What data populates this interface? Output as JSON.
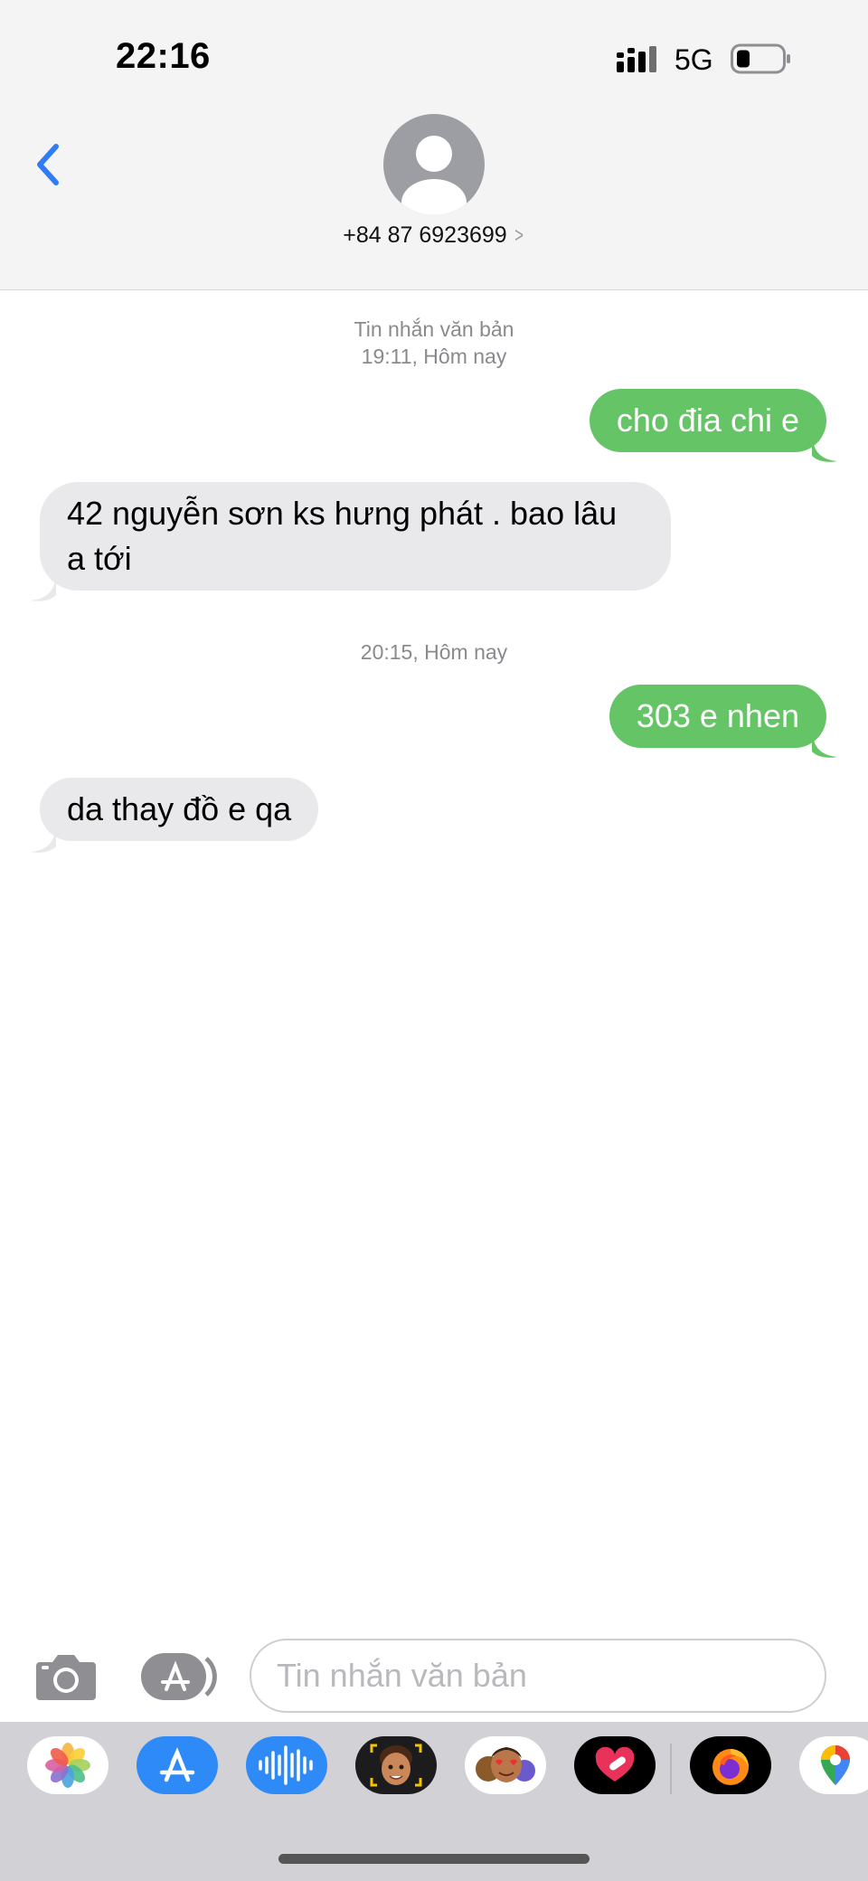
{
  "status_bar": {
    "time": "22:16",
    "network": "5G"
  },
  "header": {
    "contact": "+84 87 6923699"
  },
  "conversation": {
    "stamp1": {
      "label": "Tin nhắn văn bản",
      "time": "19:11",
      "day": "Hôm nay"
    },
    "stamp2": {
      "time": "20:15",
      "day": "Hôm nay"
    },
    "messages": [
      {
        "direction": "out",
        "text": "cho đia chi e"
      },
      {
        "direction": "in",
        "text": "42 nguyễn sơn ks hưng phát . bao lâu a tới"
      },
      {
        "direction": "out",
        "text": "303 e nhen"
      },
      {
        "direction": "in",
        "text": "da thay đồ e qa"
      }
    ]
  },
  "input": {
    "placeholder": "Tin nhắn văn bản"
  },
  "drawer": {
    "apps": [
      "photos-icon",
      "app-store-icon",
      "audio-message-icon",
      "memoji-icon",
      "animoji-stickers-icon",
      "digital-touch-icon",
      "firefox-icon",
      "google-maps-icon"
    ]
  },
  "colors": {
    "outgoing": "#65c466",
    "incoming": "#e9e9eb",
    "accent": "#2f7cf6",
    "background": "#ffffff",
    "header": "#f4f4f5"
  }
}
